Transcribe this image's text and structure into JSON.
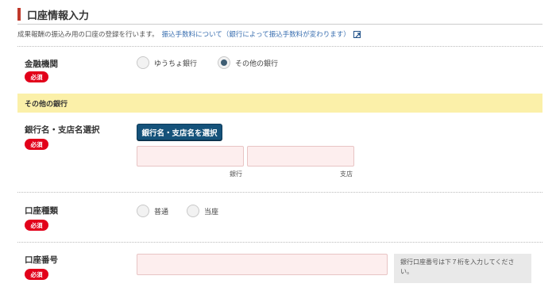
{
  "section": {
    "title": "口座情報入力",
    "description": "成果報酬の振込み用の口座の登録を行います。",
    "link_text": "振込手数料について（銀行によって振込手数料が変わります）"
  },
  "required_badge": "必須",
  "financial_institution": {
    "label": "金融機関",
    "options": [
      "ゆうちょ銀行",
      "その他の銀行"
    ],
    "selected": "その他の銀行"
  },
  "other_bank": {
    "band_title": "その他の銀行"
  },
  "bank_branch": {
    "label": "銀行名・支店名選択",
    "button_label": "銀行名・支店名を選択",
    "bank_sub_label": "銀行",
    "branch_sub_label": "支店",
    "bank_value": "",
    "branch_value": ""
  },
  "account_type": {
    "label": "口座種類",
    "options": [
      "普通",
      "当座"
    ],
    "selected": ""
  },
  "account_number": {
    "label": "口座番号",
    "value": "",
    "hint": "銀行口座番号は下７桁を入力してください。"
  },
  "colors": {
    "accent_bar": "#c0392b",
    "required_badge": "#e2001a",
    "band": "#fbf0a9",
    "button": "#15527a",
    "input_bg": "#fdeeee"
  }
}
